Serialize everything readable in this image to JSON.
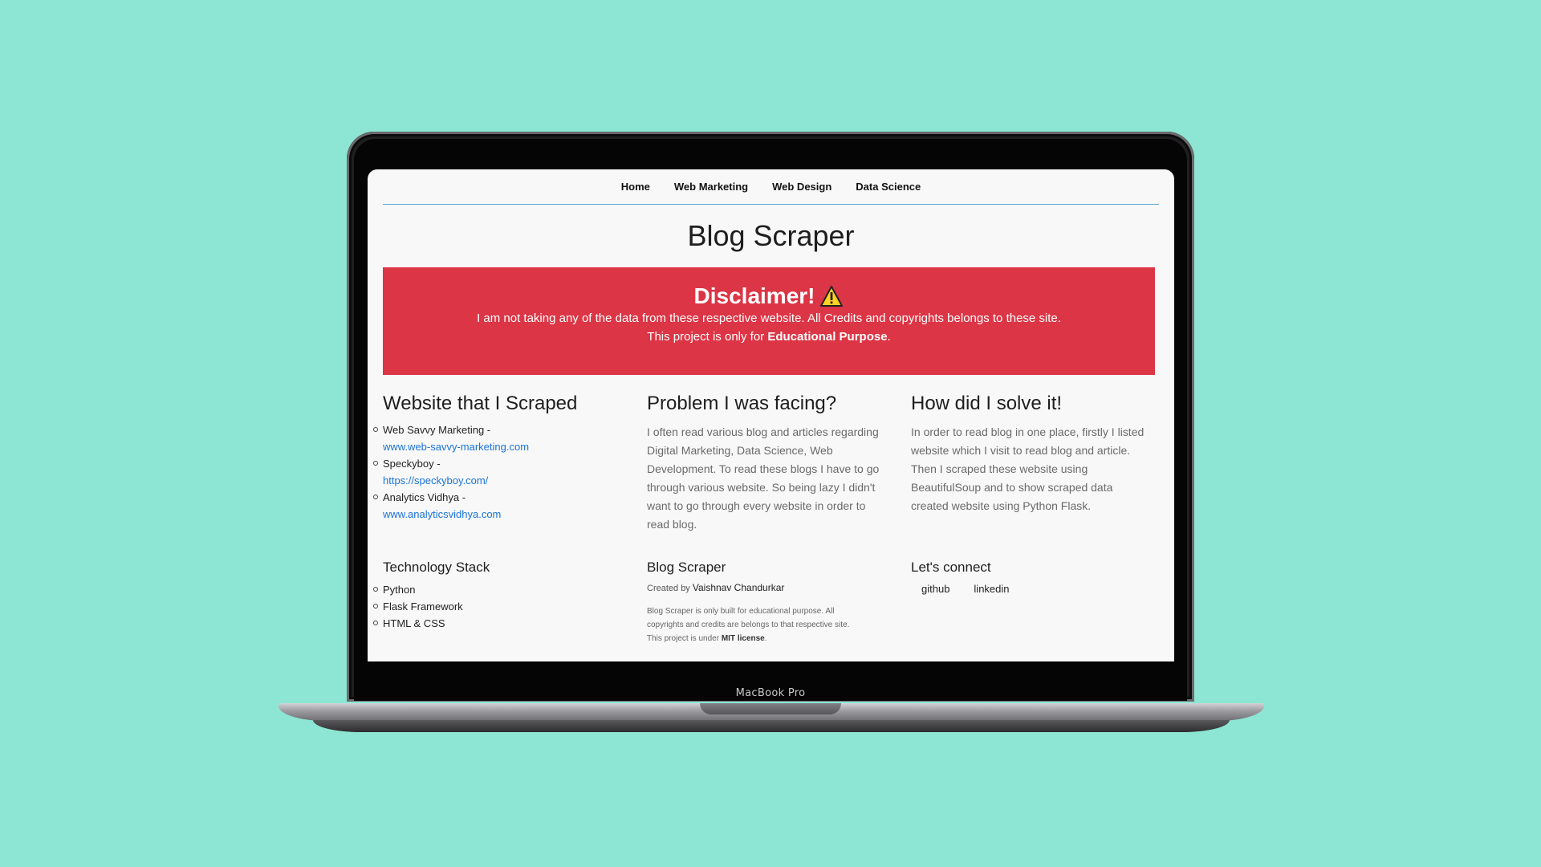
{
  "nav": {
    "items": [
      "Home",
      "Web Marketing",
      "Web Design",
      "Data Science"
    ]
  },
  "page_title": "Blog Scraper",
  "disclaimer": {
    "title": "Disclaimer!",
    "icon": "warning-icon",
    "line1": "I am not taking any of the data from these respective website. All Credits and copyrights belongs to these site.",
    "line2_prefix": "This project is only for ",
    "line2_bold": "Educational Purpose",
    "line2_suffix": "."
  },
  "websites": {
    "heading": "Website that I Scraped",
    "items": [
      {
        "name": "Web Savvy Marketing -",
        "url": "www.web-savvy-marketing.com"
      },
      {
        "name": "Speckyboy -",
        "url": "https://speckyboy.com/"
      },
      {
        "name": "Analytics Vidhya -",
        "url": "www.analyticsvidhya.com"
      }
    ]
  },
  "problem": {
    "heading": "Problem I was facing?",
    "text": "I often read various blog and articles regarding Digital Marketing, Data Science, Web Development. To read these blogs I have to go through various website. So being lazy I didn't want to go through every website in order to read blog."
  },
  "solution": {
    "heading": "How did I solve it!",
    "text": "In order to read blog in one place, firstly I listed website which I visit to read blog and article. Then I scraped these website using BeautifulSoup and to show scraped data created website using Python Flask."
  },
  "footer": {
    "stack_heading": "Technology Stack",
    "stack": [
      "Python",
      "Flask Framework",
      "HTML & CSS"
    ],
    "about_heading": "Blog Scraper",
    "created_by": "Created by ",
    "author": "Vaishnav Chandurkar",
    "note_line1": "Blog Scraper is only built for educational purpose. All",
    "note_line2": "copyrights and credits are belongs to that respective site.",
    "note_line3_prefix": "This project is under ",
    "note_license": "MIT license",
    "note_line3_suffix": ".",
    "connect_heading": "Let's connect",
    "links": [
      "github",
      "linkedin"
    ]
  },
  "device_label": "MacBook Pro",
  "colors": {
    "background": "#8de6d3",
    "disclaimer": "#dc3545",
    "link": "#1a73d9",
    "nav_rule": "#66a9d6"
  }
}
